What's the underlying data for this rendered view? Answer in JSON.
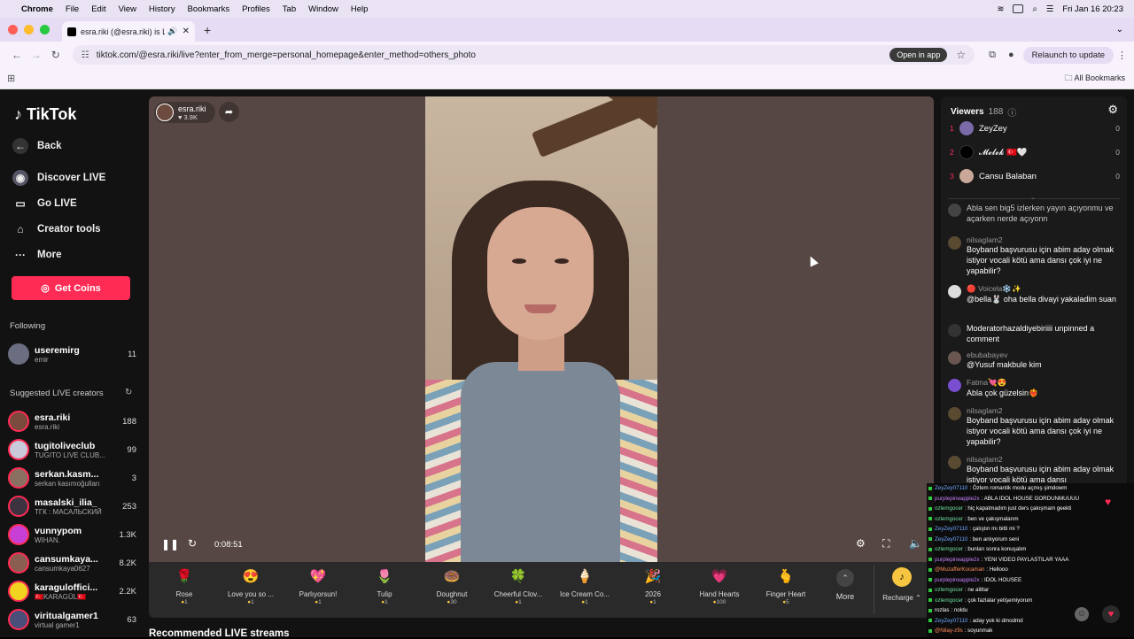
{
  "menubar": {
    "app": "Chrome",
    "items": [
      "File",
      "Edit",
      "View",
      "History",
      "Bookmarks",
      "Profiles",
      "Tab",
      "Window",
      "Help"
    ],
    "datetime": "Fri Jan 16  20:23"
  },
  "tab": {
    "title": "esra.riki (@esra.riki) is LIVE"
  },
  "address": {
    "url": "tiktok.com/@esra.riki/live?enter_from_merge=personal_homepage&enter_method=others_photo",
    "open_in_app": "Open in app",
    "relaunch": "Relaunch to update"
  },
  "bookmarks": {
    "all": "All Bookmarks"
  },
  "sidebar": {
    "logo": "TikTok",
    "back": "Back",
    "discover": "Discover LIVE",
    "go_live": "Go LIVE",
    "creator_tools": "Creator tools",
    "more": "More",
    "coins": "Get Coins",
    "following_label": "Following",
    "following": [
      {
        "name": "useremirg",
        "sub": "emir",
        "count": "11"
      }
    ],
    "suggested_label": "Suggested LIVE creators",
    "suggested": [
      {
        "name": "esra.riki",
        "sub": "esra.riki",
        "count": "188"
      },
      {
        "name": "tugitoliveclub",
        "sub": "TUGITO LIVE CLUB...",
        "count": "99"
      },
      {
        "name": "serkan.kasm...",
        "sub": "serkan kasımoğulları",
        "count": "3"
      },
      {
        "name": "masalski_ilia_",
        "sub": "ТГК : МАСАЛЬСКИЙ",
        "count": "253"
      },
      {
        "name": "vunnypom",
        "sub": "WIHAN.",
        "count": "1.3K"
      },
      {
        "name": "cansumkaya...",
        "sub": "cansumkaya0627",
        "count": "8.2K"
      },
      {
        "name": "karaguloffici...",
        "sub": "🇹🇷KARAGÜL🇹🇷",
        "count": "2.2K"
      },
      {
        "name": "viritualgamer1",
        "sub": "virtual gamer1",
        "count": "63"
      }
    ]
  },
  "player": {
    "host_name": "esra.riki",
    "host_likes": "3.9K",
    "elapsed": "0:08:51"
  },
  "gifts": [
    {
      "name": "Rose",
      "price": "1",
      "icon": "🌹"
    },
    {
      "name": "Love you so ...",
      "price": "1",
      "icon": "😍"
    },
    {
      "name": "Parlıyorsun!",
      "price": "1",
      "icon": "💖"
    },
    {
      "name": "Tulip",
      "price": "1",
      "icon": "🌷"
    },
    {
      "name": "Doughnut",
      "price": "30",
      "icon": "🍩"
    },
    {
      "name": "Cheerful Clov...",
      "price": "1",
      "icon": "🍀"
    },
    {
      "name": "Ice Cream Co...",
      "price": "1",
      "icon": "🍦"
    },
    {
      "name": "2026",
      "price": "1",
      "icon": "🎉"
    },
    {
      "name": "Hand Hearts",
      "price": "100",
      "icon": "💗"
    },
    {
      "name": "Finger Heart",
      "price": "5",
      "icon": "🫰"
    }
  ],
  "gifts_more": "More",
  "recharge": "Recharge",
  "recommended": "Recommended LIVE streams",
  "viewers": {
    "label": "Viewers",
    "count": "188",
    "list": [
      {
        "rank": "1",
        "name": "ZeyZey",
        "pts": "0"
      },
      {
        "rank": "2",
        "name": "𝓜𝓮𝓵𝓮𝓴 🇹🇷🤍",
        "pts": "0"
      },
      {
        "rank": "3",
        "name": "Cansu Balaban",
        "pts": "0"
      }
    ]
  },
  "chat": [
    {
      "name": "",
      "text": "Abla sen big5 izlerken yayın açıyonmu ve açarken nerde açıyonn"
    },
    {
      "name": "nilsaglam2",
      "text": "Boyband başvurusu için abim aday olmak istiyor vocali kötü ama dansı çok iyi ne yapabilir?"
    },
    {
      "name": "🔴 Voicela❄️✨",
      "text": "@bella🐰 oha bella divayi yakaladim suan"
    },
    {
      "name": "",
      "text": "Moderatorhazaldiyebiriiii unpinned a comment"
    },
    {
      "name": "ebubabayev",
      "text": "@Yusuf makbule kim"
    },
    {
      "name": "Fatma💘😍",
      "text": "Abla çok güzelsin❤️‍🔥"
    },
    {
      "name": "nilsaglam2",
      "text": "Boyband başvurusu için abim aday olmak istiyor vocali kötü ama dansı çok iyi ne yapabilir?"
    },
    {
      "name": "nilsaglam2",
      "text": "Boyband başvurusu için abim aday olmak istiyor vocali kötü ama dansı"
    }
  ],
  "overlay_chat": [
    {
      "user": "ZeyZey07110",
      "text": ": Özlem romantik modu açmış şimdowm"
    },
    {
      "user": "purplepineapple2x",
      "text": ": ABLA IDOL HOUSE GORDUNMUUUU"
    },
    {
      "user": "ozlemgocer",
      "text": ": hiç kapatmadım just ders çakışmam geekti"
    },
    {
      "user": "ozlemgocer",
      "text": ": ben ve çakışmalarım"
    },
    {
      "user": "ZeyZey07110",
      "text": ": çalıştın mı bitti mi ?"
    },
    {
      "user": "ZeyZey07110",
      "text": ": ben anlıyorum seni"
    },
    {
      "user": "ozlemgocer",
      "text": ": bunları sonra konuşalım"
    },
    {
      "user": "purplepineapple2x",
      "text": ": YENI VIDEO PAYLASTILAR YAAA"
    },
    {
      "user": "@MuzafferKocaman",
      "text": ": Hellooo"
    },
    {
      "user": "purplepineapple2x",
      "text": ": IDOL HOUSEE"
    },
    {
      "user": "ozlemgocer",
      "text": ": ne alittar"
    },
    {
      "user": "ozlemgocer",
      "text": ": çok fazlalar yetişemiyorum"
    },
    {
      "user": "rozlas",
      "text": ": noldu"
    },
    {
      "user": "ZeyZey07110",
      "text": ": aday yok ki dmodmd"
    },
    {
      "user": "@Nilay-z9s",
      "text": ": soyunmak"
    }
  ],
  "colors": {
    "accent": "#fe2c55",
    "rank": "#fe2c55"
  }
}
